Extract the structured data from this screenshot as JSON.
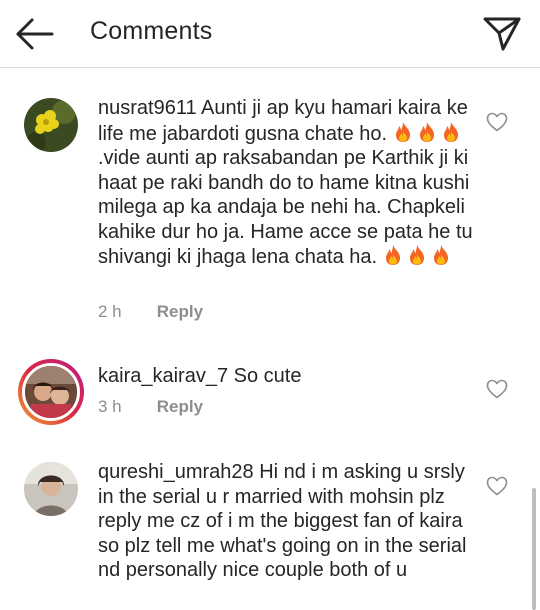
{
  "header": {
    "title": "Comments"
  },
  "icons": {
    "back": "arrow-left-icon",
    "share": "direct-send-icon",
    "like": "heart-outline-icon",
    "emoji": "fire-emoji"
  },
  "colors": {
    "text": "#262626",
    "meta": "#8e8e8e",
    "divider": "#dbdbdb",
    "story_ring": "#dc2743"
  },
  "comments": [
    {
      "username": "nusrat9611",
      "text_part1": "Aunti ji ap kyu hamari kaira ke life me jabardoti gusna chate ho.",
      "text_part2": ".vide aunti ap raksabandan pe Karthik ji ki haat pe raki bandh do to hame kitna kushi milega ap ka andaja be nehi ha. Chapkeli kahike dur ho ja. Hame acce se pata he tu shivangi ki jhaga lena chata ha.",
      "time": "2 h",
      "reply_label": "Reply"
    },
    {
      "username": "kaira_kairav_7",
      "text": "So cute",
      "time": "3 h",
      "reply_label": "Reply"
    },
    {
      "username": "qureshi_umrah28",
      "text": "Hi nd i m asking u srsly in the serial u r married with mohsin plz reply me cz of i m the biggest fan of kaira so plz tell me what's going on in the serial nd personally nice couple both of u"
    }
  ]
}
